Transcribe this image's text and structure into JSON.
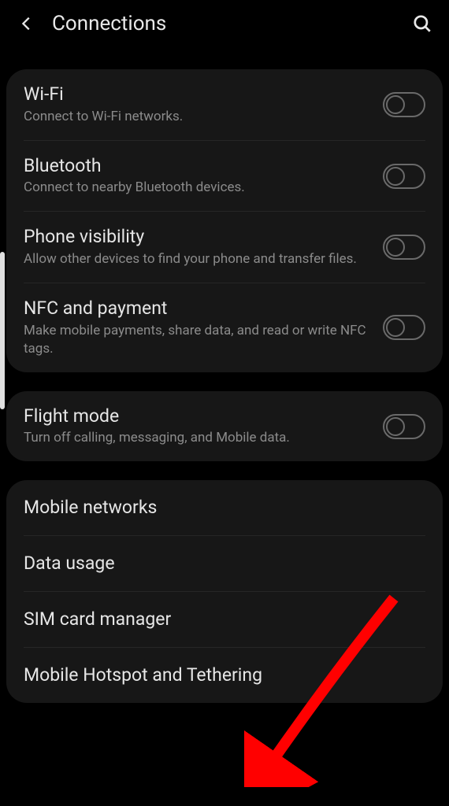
{
  "header": {
    "title": "Connections"
  },
  "groups": [
    {
      "items": [
        {
          "title": "Wi-Fi",
          "sub": "Connect to Wi-Fi networks.",
          "toggle": true
        },
        {
          "title": "Bluetooth",
          "sub": "Connect to nearby Bluetooth devices.",
          "toggle": true
        },
        {
          "title": "Phone visibility",
          "sub": "Allow other devices to find your phone and transfer files.",
          "toggle": true
        },
        {
          "title": "NFC and payment",
          "sub": "Make mobile payments, share data, and read or write NFC tags.",
          "toggle": true
        }
      ]
    },
    {
      "items": [
        {
          "title": "Flight mode",
          "sub": "Turn off calling, messaging, and Mobile data.",
          "toggle": true
        }
      ]
    },
    {
      "items": [
        {
          "title": "Mobile networks",
          "toggle": false
        },
        {
          "title": "Data usage",
          "toggle": false
        },
        {
          "title": "SIM card manager",
          "toggle": false
        },
        {
          "title": "Mobile Hotspot and Tethering",
          "toggle": false
        }
      ]
    }
  ],
  "annotation": {
    "arrow_color": "#ff0000"
  }
}
